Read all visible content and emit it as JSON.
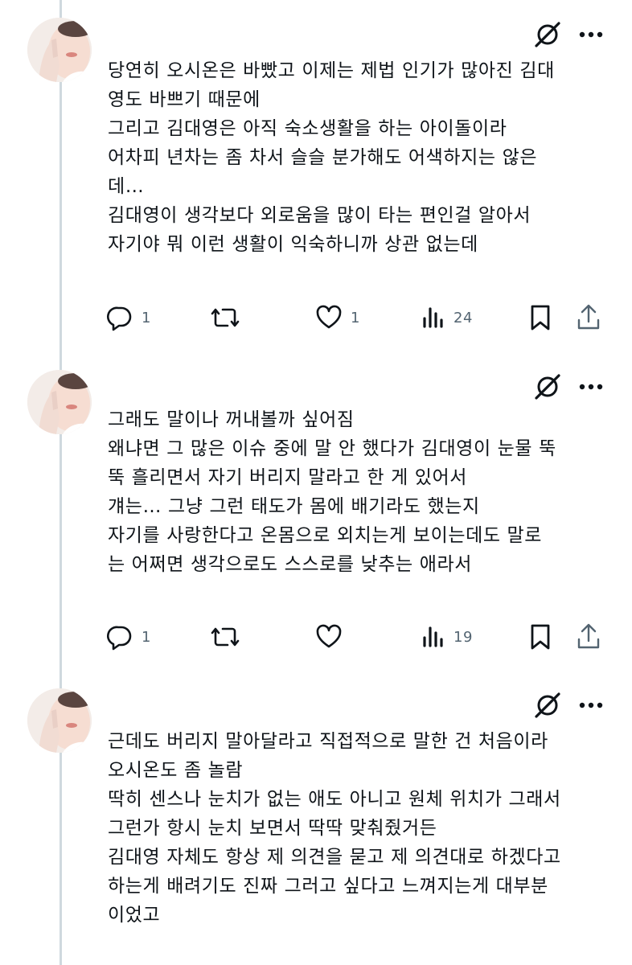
{
  "posts": [
    {
      "lines": [
        "당연히 오시온은 바빴고 이제는 제법 인기가 많아진 김대",
        "영도 바쁘기 때문에",
        "그리고 김대영은 아직 숙소생활을 하는 아이돌이라",
        "어차피 년차는 좀 차서 슬슬 분가해도 어색하지는 않은",
        "데…",
        "김대영이 생각보다 외로움을 많이 타는 편인걸 알아서",
        "자기야 뭐 이런 생활이 익숙하니까 상관 없는데"
      ],
      "reply_count": "1",
      "repost_count": "",
      "like_count": "1",
      "view_count": "24"
    },
    {
      "lines": [
        "그래도 말이나 꺼내볼까 싶어짐",
        "왜냐면 그 많은 이슈 중에 말 안 했다가 김대영이 눈물 뚝",
        "뚝 흘리면서 자기 버리지 말라고 한 게 있어서",
        "걔는… 그냥 그런 태도가 몸에 배기라도 했는지",
        "자기를 사랑한다고 온몸으로 외치는게 보이는데도 말로",
        "는 어쩌면 생각으로도 스스로를 낮추는 애라서"
      ],
      "reply_count": "1",
      "repost_count": "",
      "like_count": "",
      "view_count": "19"
    },
    {
      "lines": [
        "근데도 버리지 말아달라고 직접적으로 말한 건 처음이라",
        "오시온도 좀 놀람",
        "딱히 센스나 눈치가 없는 애도 아니고 원체 위치가 그래서",
        "그런가 항시 눈치 보면서 딱딱 맞춰줬거든",
        "김대영 자체도 항상 제 의견을 묻고 제 의견대로 하겠다고",
        "하는게 배려기도 진짜 그러고 싶다고 느껴지는게 대부분",
        "이었고"
      ]
    }
  ],
  "icons": {
    "grok": "grok-icon",
    "more": "more-icon",
    "reply": "reply-icon",
    "repost": "repost-icon",
    "like": "like-icon",
    "views": "views-icon",
    "bookmark": "bookmark-icon",
    "share": "share-icon"
  },
  "colors": {
    "text": "#0f1419",
    "muted": "#536471",
    "thread_line": "#cfd9de"
  }
}
